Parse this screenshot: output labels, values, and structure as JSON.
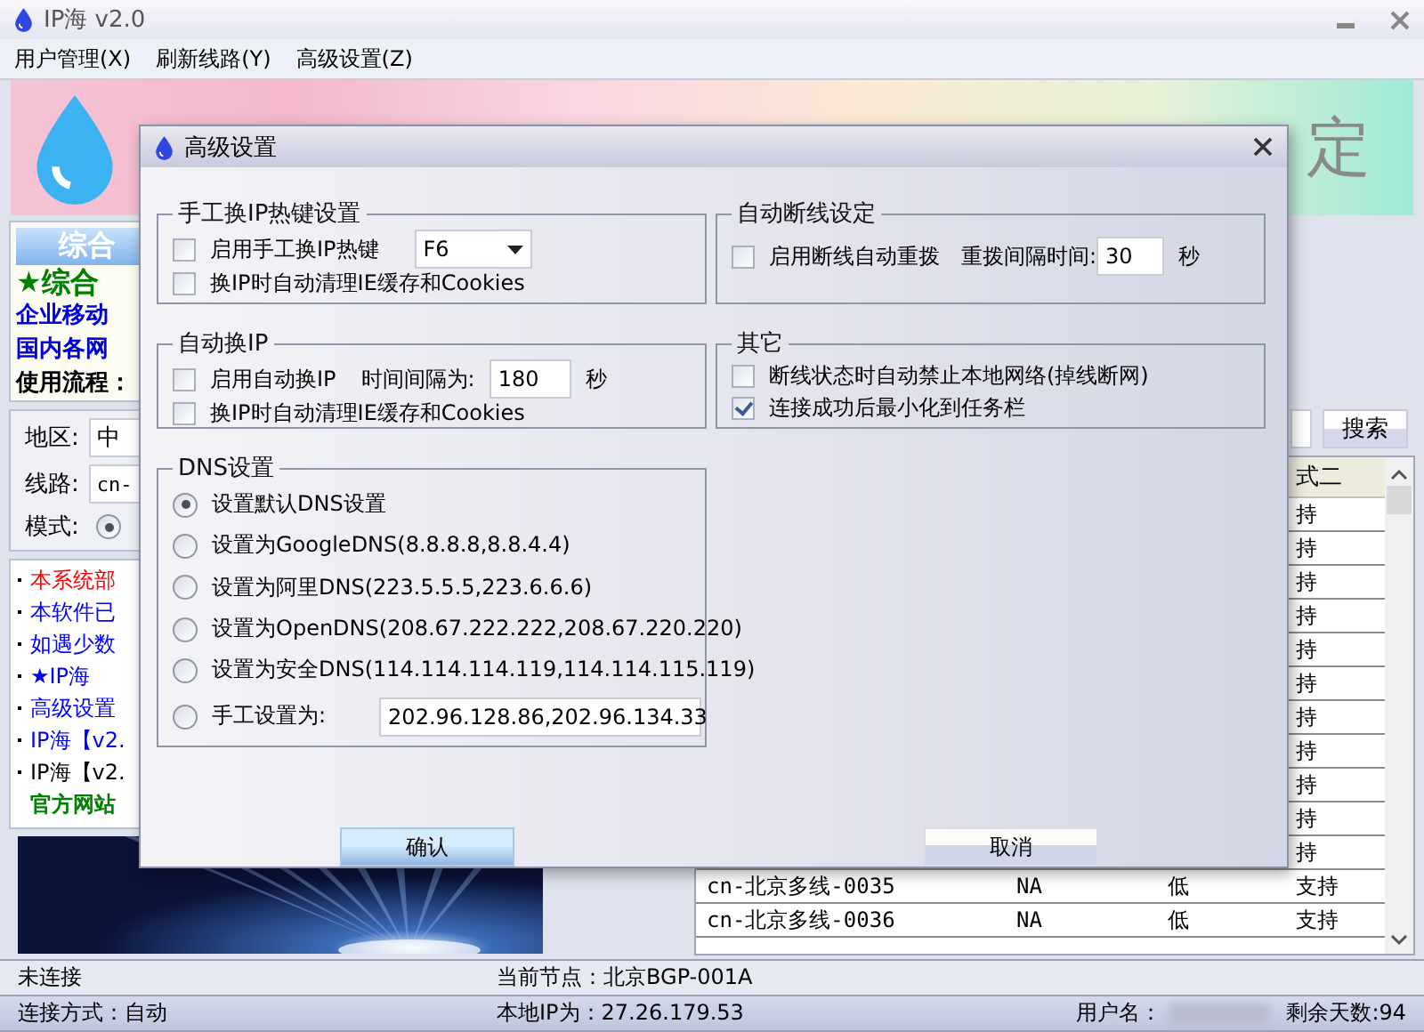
{
  "window": {
    "title": "IP海 v2.0"
  },
  "menu": [
    "用户管理(X)",
    "刷新线路(Y)",
    "高级设置(Z)"
  ],
  "banner": {
    "slogan": "定"
  },
  "intro": {
    "header": "综合",
    "lines": [
      {
        "text": "★综合",
        "kind": "headline"
      },
      {
        "text": "企业移动",
        "kind": "link"
      },
      {
        "text": "国内各网",
        "kind": "link"
      },
      {
        "text": "使用流程：",
        "kind": "plain"
      }
    ]
  },
  "filters": {
    "region_label": "地区:",
    "region_value": "中",
    "line_label": "线路:",
    "line_value": "cn-",
    "mode_label": "模式:",
    "mode_selected": true
  },
  "news": [
    {
      "text": "本系统部",
      "color": "#ff0000",
      "kind": "item"
    },
    {
      "text": "本软件已",
      "color": "#0000ff",
      "kind": "item"
    },
    {
      "text": "如遇少数",
      "color": "#0000ff",
      "kind": "item"
    },
    {
      "text": "★IP海",
      "color": "#0000ff",
      "kind": "item"
    },
    {
      "text": "高级设置",
      "color": "#0000ff",
      "kind": "item"
    },
    {
      "text": "IP海【v2.",
      "color": "#0000ff",
      "kind": "item"
    },
    {
      "text": "IP海【v2.",
      "color": "#000000",
      "kind": "item"
    },
    {
      "text": "官方网站",
      "color": "#008000",
      "kind": "link"
    }
  ],
  "search": {
    "button": "搜索"
  },
  "table": {
    "columns": [
      {
        "label": "式二"
      }
    ],
    "rows": [
      {
        "mode_2": "持"
      },
      {
        "mode_2": "持"
      },
      {
        "mode_2": "持"
      },
      {
        "mode_2": "持"
      },
      {
        "mode_2": "持"
      },
      {
        "mode_2": "持"
      },
      {
        "mode_2": "持"
      },
      {
        "mode_2": "持"
      },
      {
        "mode_2": "持"
      },
      {
        "mode_2": "持"
      },
      {
        "mode_2": "持"
      },
      {
        "name": "cn-北京多线-0035",
        "column_2": "NA",
        "column_3": "低",
        "mode_2": "支持"
      },
      {
        "name": "cn-北京多线-0036",
        "column_2": "NA",
        "column_3": "低",
        "mode_2": "支持"
      }
    ]
  },
  "status_bar": {
    "connection": "未连接",
    "node": "当前节点：北京BGP-001A",
    "mode": "连接方式：自动",
    "local_ip": "本地IP为：27.26.179.53",
    "user_label": "用户名：",
    "days_left": "剩余天数:94"
  },
  "dialog": {
    "title": "高级设置",
    "hotkey": {
      "title": "手工换IP热键设置",
      "enable": {
        "label": "启用手工换IP热键",
        "checked": false
      },
      "key": "F6",
      "clear_cache": {
        "label": "换IP时自动清理IE缓存和Cookies",
        "checked": false
      }
    },
    "auto_redial": {
      "title": "自动断线设定",
      "enable": {
        "label": "启用断线自动重拨",
        "checked": false
      },
      "interval_label": "重拨间隔时间:",
      "interval": "30",
      "unit": "秒"
    },
    "auto_switch": {
      "title": "自动换IP",
      "enable": {
        "label": "启用自动换IP",
        "checked": false
      },
      "interval_label": "时间间隔为:",
      "interval": "180",
      "unit": "秒",
      "clear_cache": {
        "label": "换IP时自动清理IE缓存和Cookies",
        "checked": false
      }
    },
    "other": {
      "title": "其它",
      "options": [
        {
          "label": "断线状态时自动禁止本地网络(掉线断网)",
          "checked": false
        },
        {
          "label": "连接成功后最小化到任务栏",
          "checked": true
        }
      ]
    },
    "dns": {
      "title": "DNS设置",
      "options": [
        {
          "label": "设置默认DNS设置",
          "selected": true
        },
        {
          "label": "设置为GoogleDNS(8.8.8.8,8.8.4.4)",
          "selected": false
        },
        {
          "label": "设置为阿里DNS(223.5.5.5,223.6.6.6)",
          "selected": false
        },
        {
          "label": "设置为OpenDNS(208.67.222.222,208.67.220.220)",
          "selected": false
        },
        {
          "label": "设置为安全DNS(114.114.114.119,114.114.115.119)",
          "selected": false
        },
        {
          "label": "手工设置为:",
          "selected": false,
          "value": "202.96.128.86,202.96.134.33"
        }
      ]
    },
    "buttons": [
      {
        "label": "确认",
        "default": true
      },
      {
        "label": "取消",
        "default": false
      }
    ]
  }
}
